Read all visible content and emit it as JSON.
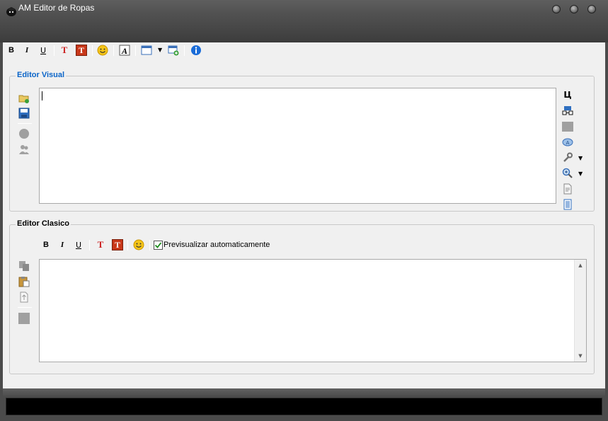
{
  "window": {
    "title": "AM Editor de Ropas",
    "icon": "app-hat-icon",
    "controls": [
      "minimize-button",
      "maximize-button",
      "close-button"
    ]
  },
  "main_toolbar": {
    "bold_label": "B",
    "italic_label": "I",
    "underline_label": "U",
    "text_color_label": "T",
    "background_color_label": "T",
    "items": [
      "bold",
      "italic",
      "underline",
      "text-color",
      "background-color",
      "emoticon",
      "font",
      "window-view",
      "dropdown",
      "add-window",
      "info"
    ]
  },
  "visual_editor": {
    "legend": "Editor Visual",
    "legend_color": "#0a64c8",
    "content": "",
    "left_tools": [
      "open-folder-icon",
      "save-disk-icon",
      "circle-icon",
      "users-icon"
    ],
    "right_tools": [
      "cyrillic-char-icon",
      "link-icon",
      "rectangle-icon",
      "globe-icon",
      "wrench-icon",
      "zoom-icon",
      "document-icon",
      "list-document-icon"
    ],
    "cyrillic_label": "Ц"
  },
  "classic_editor": {
    "legend": "Editor Clasico",
    "bold_label": "B",
    "italic_label": "I",
    "underline_label": "U",
    "text_color_label": "T",
    "background_color_label": "T",
    "auto_preview_label": "Previsualizar automaticamente",
    "auto_preview_checked": true,
    "content": "",
    "left_tools": [
      "copy-icon",
      "paste-icon",
      "import-icon",
      "square-icon"
    ]
  },
  "status": {
    "text": ""
  },
  "colors": {
    "accent_blue": "#0a64c8",
    "title_bar": "#505050",
    "status_bar": "#000000",
    "text_red": "#cc2222"
  }
}
